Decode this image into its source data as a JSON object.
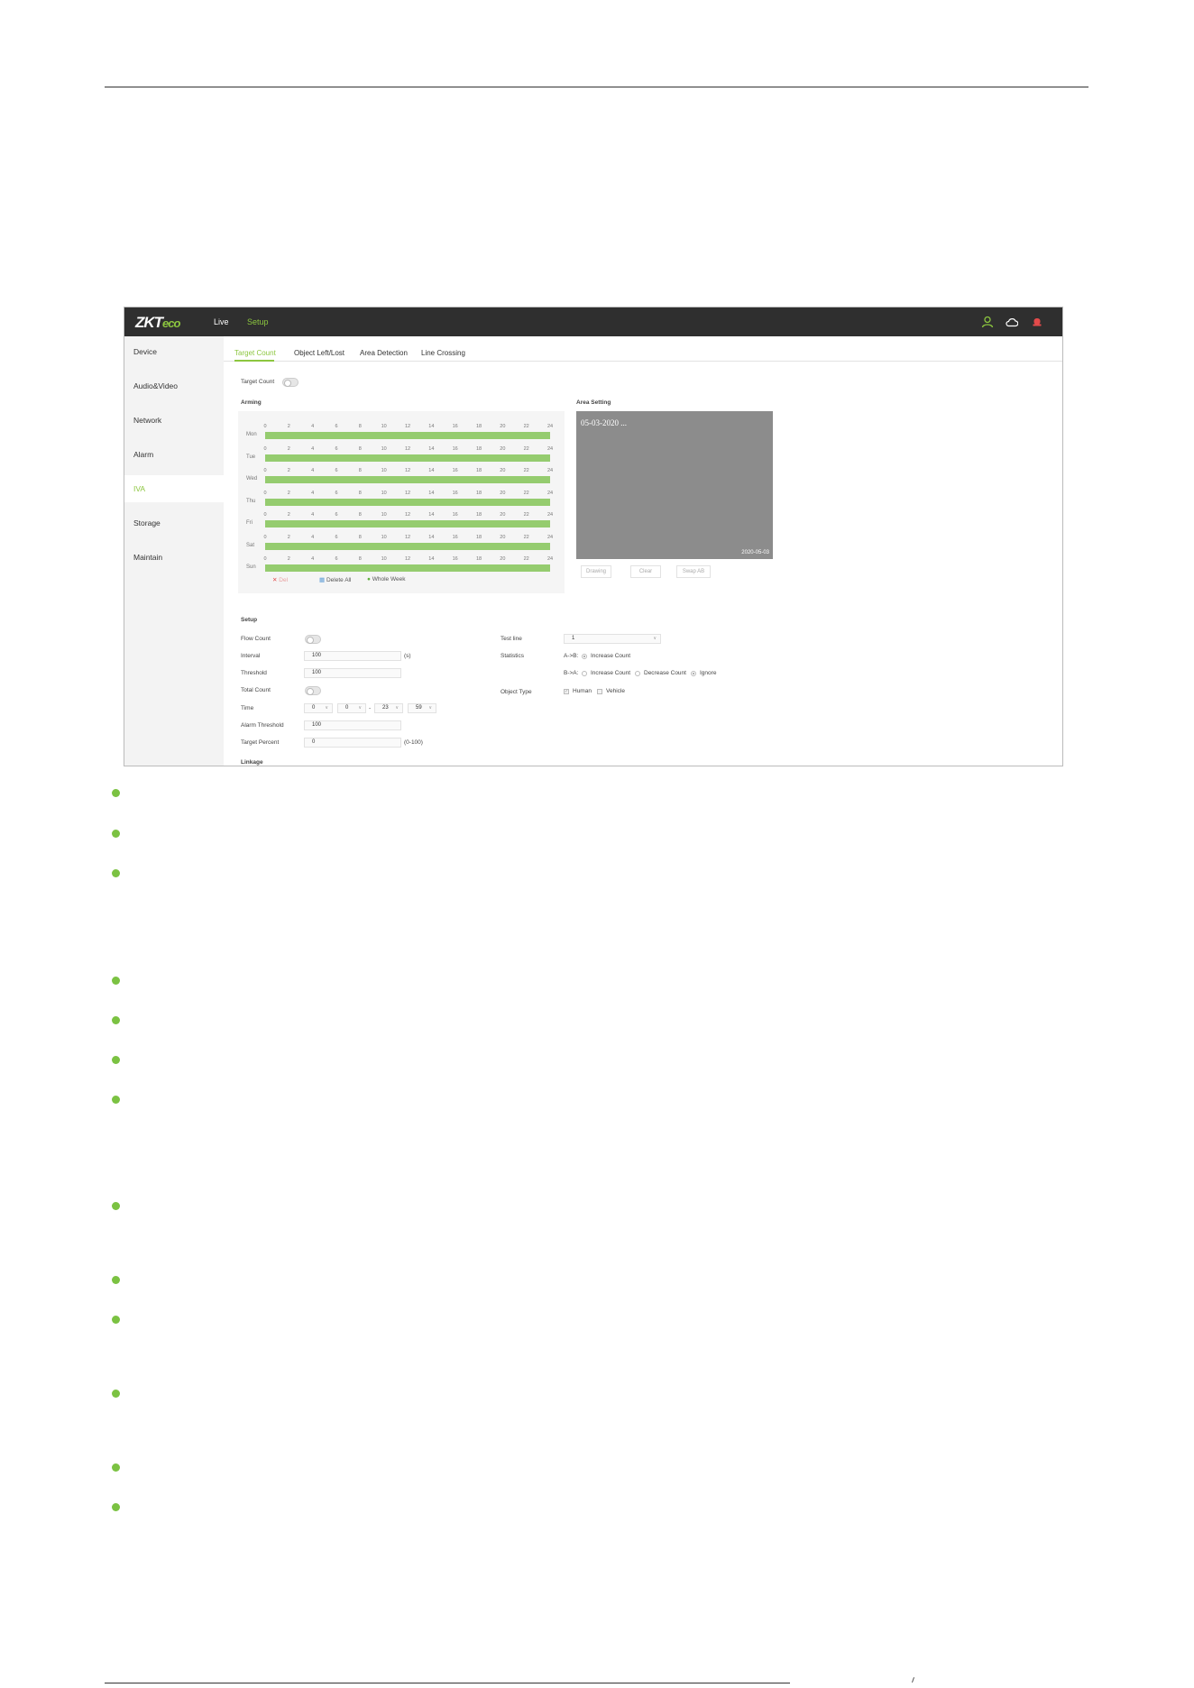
{
  "app": {
    "logo_main": "ZKT",
    "logo_accent": "eco",
    "nav_live": "Live",
    "nav_setup": "Setup"
  },
  "sidebar": {
    "items": [
      {
        "label": "Device"
      },
      {
        "label": "Audio&Video"
      },
      {
        "label": "Network"
      },
      {
        "label": "Alarm"
      },
      {
        "label": "IVA",
        "active": true
      },
      {
        "label": "Storage"
      },
      {
        "label": "Maintain"
      }
    ]
  },
  "tabs": [
    {
      "label": "Target Count",
      "active": true
    },
    {
      "label": "Object Left/Lost"
    },
    {
      "label": "Area Detection"
    },
    {
      "label": "Line Crossing"
    }
  ],
  "target_count_label": "Target Count",
  "arming": {
    "title": "Arming",
    "days": [
      "Mon",
      "Tue",
      "Wed",
      "Thu",
      "Fri",
      "Sat",
      "Sun"
    ],
    "hour_ticks": [
      "0",
      "2",
      "4",
      "6",
      "8",
      "10",
      "12",
      "14",
      "16",
      "18",
      "20",
      "22",
      "24"
    ],
    "actions": {
      "del": "Del",
      "delete_all": "Delete All",
      "whole_week": "Whole Week"
    }
  },
  "area_setting": {
    "title": "Area Setting",
    "stamp": "05-03-2020 ...",
    "stamp_br": "2020-05-03",
    "buttons": {
      "drawing": "Drawing",
      "clear": "Clear",
      "swap": "Swap AB"
    }
  },
  "setup": {
    "title": "Setup",
    "flow_count": "Flow Count",
    "interval_label": "Interval",
    "interval_value": "100",
    "interval_unit": "(s)",
    "threshold_label": "Threshold",
    "threshold_value": "100",
    "total_count": "Total Count",
    "time_label": "Time",
    "time_start_h": "0",
    "time_start_m": "0",
    "time_sep": "-",
    "time_end_h": "23",
    "time_end_m": "59",
    "alarm_threshold_label": "Alarm Threshold",
    "alarm_threshold_value": "100",
    "target_percent_label": "Target Percent",
    "target_percent_value": "0",
    "target_percent_range": "(0-100)",
    "linkage": "Linkage",
    "test_line_label": "Test line",
    "test_line_value": "1",
    "statistics_label": "Statistics",
    "a_to_b": "A->B:",
    "b_to_a": "B->A:",
    "increase_count": "Increase Count",
    "decrease_count": "Decrease Count",
    "ignore": "Ignore",
    "object_type_label": "Object Type",
    "human": "Human",
    "vehicle": "Vehicle"
  },
  "colors": {
    "accent": "#8cc63f",
    "bar": "#95cc6f",
    "topbar": "#2f2f2f",
    "bullet": "#7bc242"
  },
  "icons": [
    "user-icon",
    "cloud-icon",
    "alarm-icon",
    "delete-icon",
    "calendar-icon",
    "check-circle-icon"
  ]
}
